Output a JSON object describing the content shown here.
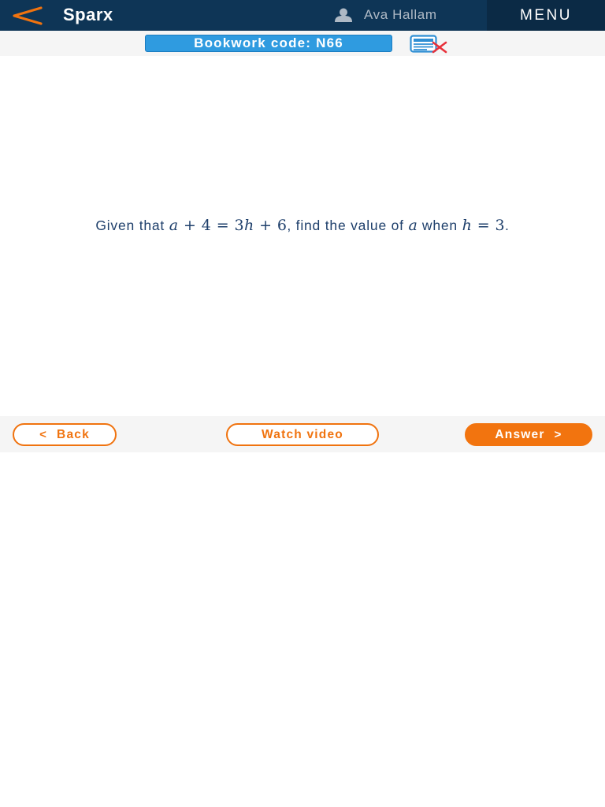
{
  "header": {
    "brand": "Sparx",
    "user_name": "Ava Hallam",
    "menu_label": "MENU"
  },
  "bookwork": {
    "label": "Bookwork code: N66"
  },
  "question": {
    "prefix": "Given that",
    "equation": {
      "lhs_var": "a",
      "lhs_op": "+",
      "lhs_num": "4",
      "eq": "=",
      "rhs_coef": "3",
      "rhs_var": "h",
      "rhs_op": "+",
      "rhs_num": "6"
    },
    "middle": ", find the value of",
    "target_var": "a",
    "when": "when",
    "cond": {
      "var": "h",
      "eq": "=",
      "num": "3"
    },
    "end": "."
  },
  "nav": {
    "back_label": "Back",
    "video_label": "Watch video",
    "answer_label": "Answer",
    "back_chevron": "<",
    "answer_chevron": ">"
  },
  "colors": {
    "header_bg": "#0e3556",
    "menu_bg": "#0b2a45",
    "accent_orange": "#f0730f",
    "bookwork_blue": "#2f9be0",
    "question_text": "#1e3f6b"
  },
  "icons": {
    "back": "chevron-left-icon",
    "user": "user-icon",
    "calculator": "calculator-not-allowed-icon"
  }
}
